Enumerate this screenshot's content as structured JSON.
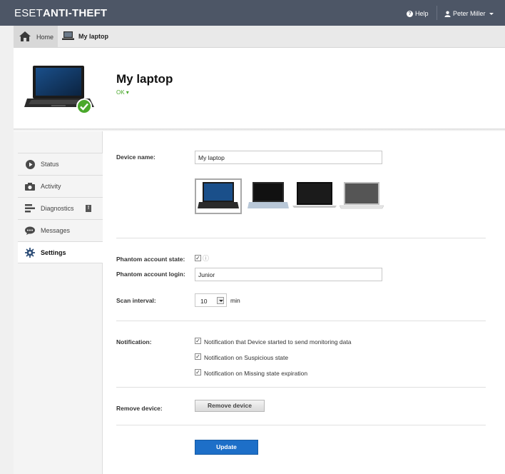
{
  "header": {
    "logo_thin": "ESET",
    "logo_bold": "ANTI-THEFT",
    "help_label": "Help",
    "user_label": "Peter Miller"
  },
  "breadcrumb": {
    "home_label": "Home",
    "device_label": "My laptop"
  },
  "device": {
    "title": "My laptop",
    "status": "OK ▾"
  },
  "sidebar": {
    "items": [
      {
        "label": "Status",
        "icon": "play-icon"
      },
      {
        "label": "Activity",
        "icon": "camera-icon"
      },
      {
        "label": "Diagnostics",
        "icon": "diagnostics-icon",
        "badge": "!"
      },
      {
        "label": "Messages",
        "icon": "chat-icon"
      },
      {
        "label": "Settings",
        "icon": "gear-icon",
        "active": true
      }
    ]
  },
  "form": {
    "device_name_label": "Device name:",
    "device_name_value": "My laptop",
    "phantom_state_label": "Phantom account state:",
    "phantom_login_label": "Phantom account login:",
    "phantom_login_value": "Junior",
    "scan_interval_label": "Scan interval:",
    "scan_interval_value": "10",
    "scan_interval_unit": "min",
    "notification_label": "Notification:",
    "notifications": [
      "Notification that Device started to send monitoring data",
      "Notification on Suspicious state",
      "Notification on Missing state expiration"
    ],
    "remove_label": "Remove device:",
    "remove_button": "Remove device",
    "update_button": "Update"
  },
  "colors": {
    "topbar": "#4d5666",
    "status_ok": "#4aa82b",
    "update_button": "#1d6fc8"
  }
}
